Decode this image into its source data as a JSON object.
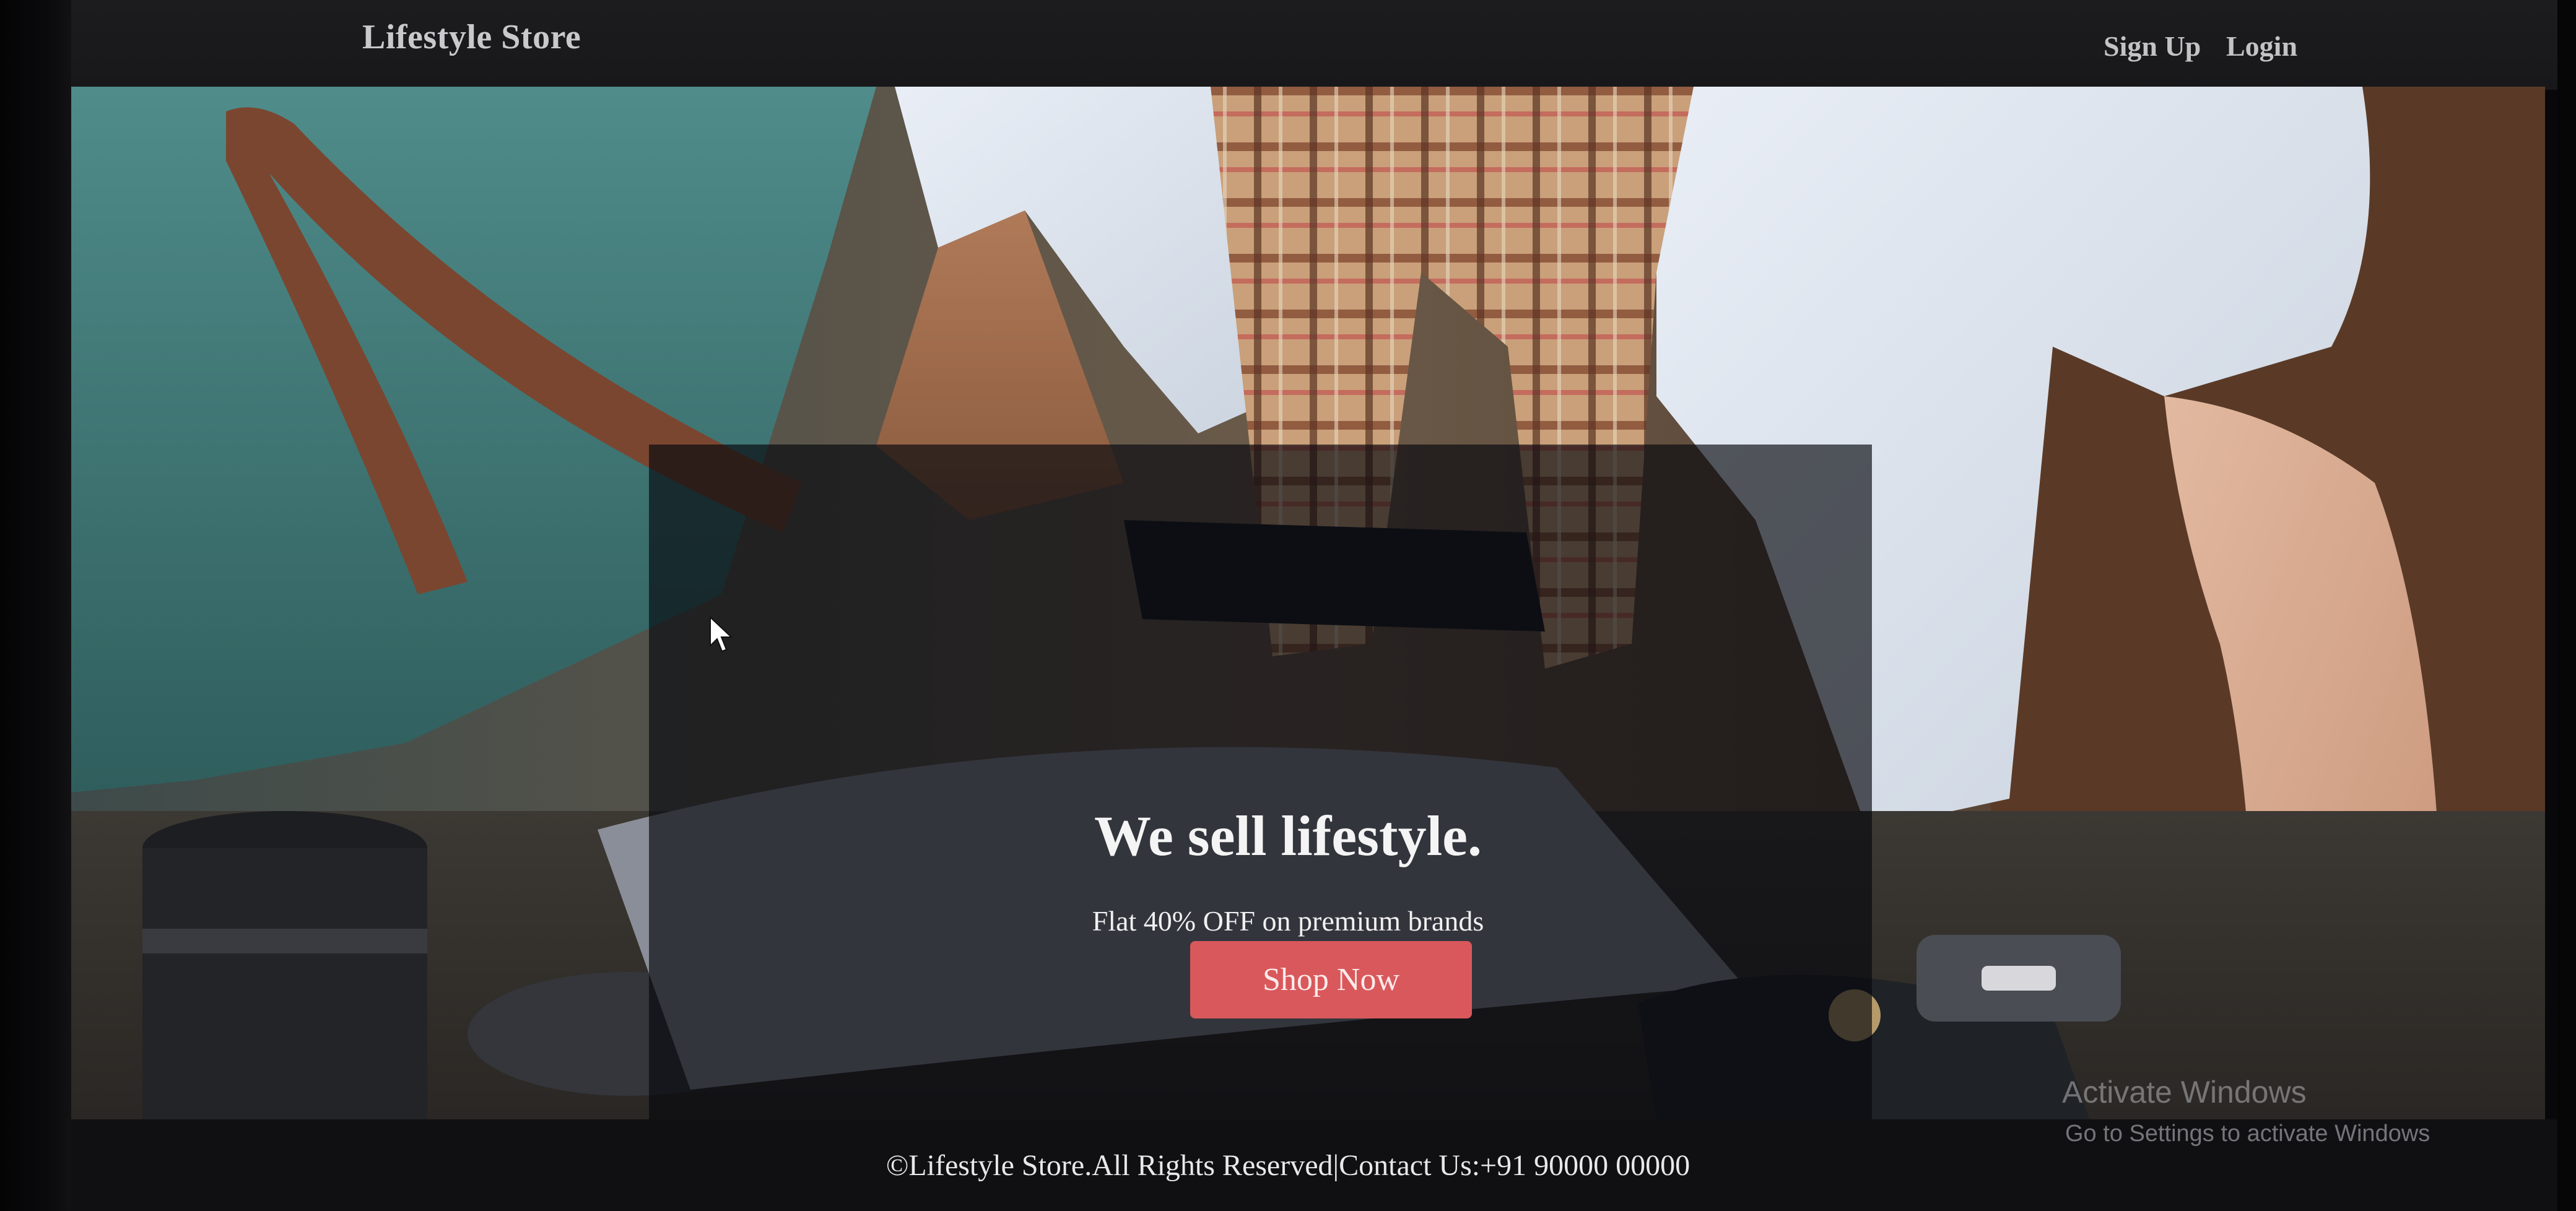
{
  "navbar": {
    "brand": "Lifestyle Store",
    "links": [
      "Sign Up",
      "Login"
    ]
  },
  "hero": {
    "image_description": "Two people with a teal tote bag, plaid scarf, phone, camera lens and wallet on a table",
    "title": "We sell lifestyle.",
    "subtitle": "Flat 40% OFF on premium brands",
    "cta_label": "Shop Now"
  },
  "footer": {
    "text": "©Lifestyle Store.All Rights Reserved|Contact Us:+91 90000 00000"
  },
  "os_watermark": {
    "line1": "Activate Windows",
    "line2": "Go to Settings to activate Windows"
  },
  "colors": {
    "navbar_bg": "#1c1c1f",
    "cta_bg": "#d9585b",
    "caption_overlay": "rgba(6,8,14,0.66)",
    "footer_bg": "#101012"
  }
}
